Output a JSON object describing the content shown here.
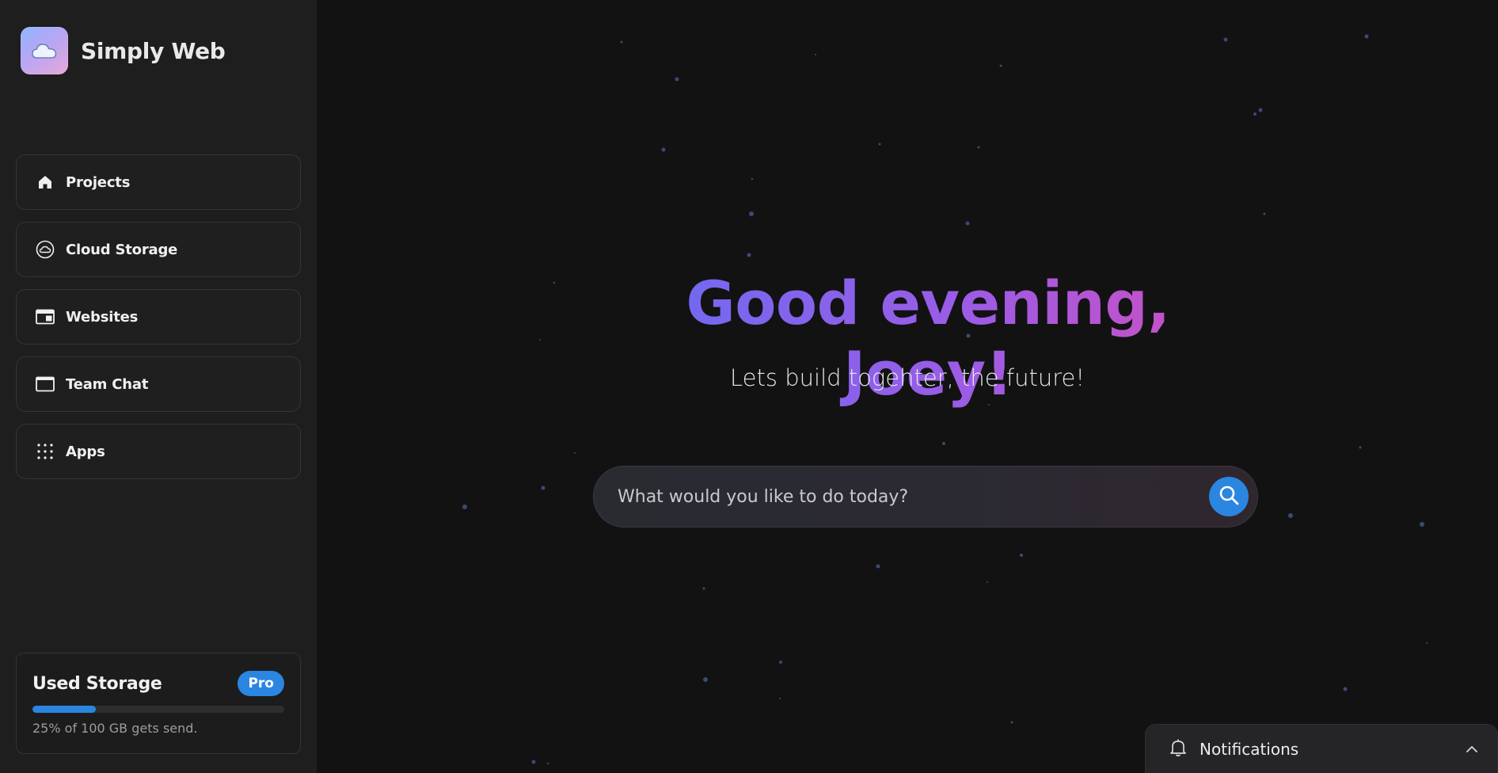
{
  "brand": {
    "name": "Simply Web",
    "logo_icon": "cloud-logo-icon"
  },
  "sidebar": {
    "items": [
      {
        "label": "Projects",
        "icon": "home-icon"
      },
      {
        "label": "Cloud Storage",
        "icon": "cloud-icon"
      },
      {
        "label": "Websites",
        "icon": "browser-icon"
      },
      {
        "label": "Team Chat",
        "icon": "window-icon"
      },
      {
        "label": "Apps",
        "icon": "grid-dots-icon"
      }
    ]
  },
  "storage": {
    "title": "Used Storage",
    "badge": "Pro",
    "used_fraction": 0.25,
    "caption": "25% of 100 GB gets send."
  },
  "main": {
    "greeting": "Good evening, Joey!",
    "subtitle": "Lets build togehter, the future!",
    "search": {
      "placeholder": "What would you like to do today?",
      "button_icon": "search-icon"
    }
  },
  "notifications": {
    "label": "Notifications",
    "icon": "bell-icon",
    "toggle_icon": "chevron-up-icon"
  },
  "colors": {
    "accent": "#2a86e0",
    "greeting_gradient_start": "#6a6cf2",
    "greeting_gradient_end": "#cf4fbf",
    "sidebar_bg": "#1e1e1f",
    "main_bg": "#121213"
  }
}
